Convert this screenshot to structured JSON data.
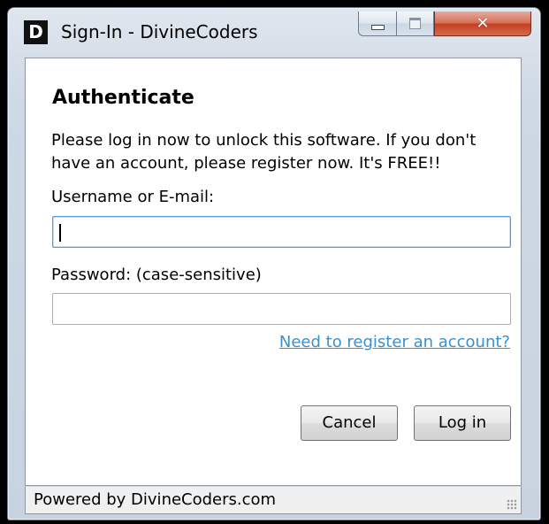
{
  "window": {
    "title": "Sign-In - DivineCoders",
    "icon_letter": "D",
    "controls": {
      "minimize": "minimize-icon",
      "maximize": "maximize-icon",
      "close": "✕"
    }
  },
  "form": {
    "heading": "Authenticate",
    "intro": "Please log in now to unlock this software. If you don't have an account, please register now. It's FREE!!",
    "username_label": "Username or E-mail:",
    "username_value": "",
    "password_label": "Password: (case-sensitive)",
    "password_value": "",
    "register_link": "Need to register an account?"
  },
  "buttons": {
    "cancel": "Cancel",
    "login": "Log in"
  },
  "status": {
    "text": "Powered by DivineCoders.com"
  },
  "colors": {
    "link": "#3a8fd0",
    "close_button": "#c43f20",
    "focus_border": "#5b9bd5"
  }
}
